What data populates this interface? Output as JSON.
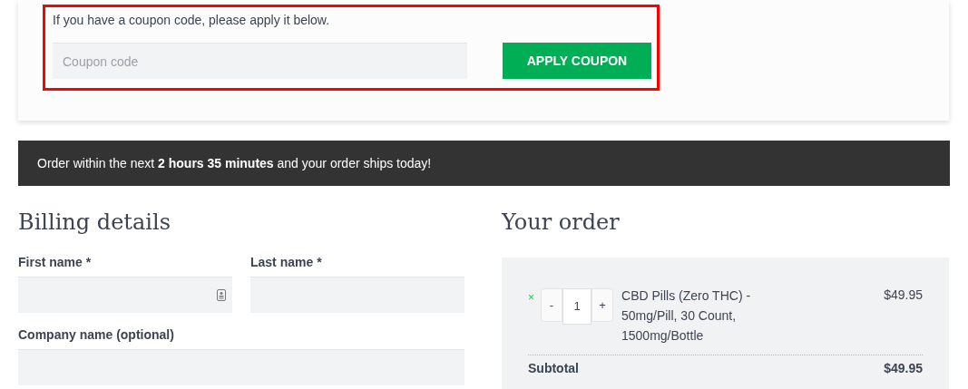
{
  "coupon": {
    "prompt": "If you have a coupon code, please apply it below.",
    "placeholder": "Coupon code",
    "button": "APPLY COUPON",
    "highlighted": true
  },
  "banner": "Order within the next **2 hours 35 minutes** and your order ships today!",
  "billing": {
    "title": "Billing details",
    "fields": [
      {
        "label": "First name *",
        "kind": "half",
        "autofill_icon": true
      },
      {
        "label": "Last name *",
        "kind": "half",
        "autofill_icon": false
      },
      {
        "label": "Company name (optional)",
        "kind": "full",
        "autofill_icon": false
      }
    ]
  },
  "order": {
    "title": "Your order",
    "items": [
      {
        "remove": "×",
        "minus": "-",
        "quantity": "1",
        "plus": "+",
        "name": "CBD Pills (Zero THC) - 50mg/Pill, 30 Count, 1500mg/Bottle",
        "price": "$49.95"
      }
    ],
    "subtotal": {
      "label": "Subtotal",
      "value": "$49.95"
    }
  }
}
